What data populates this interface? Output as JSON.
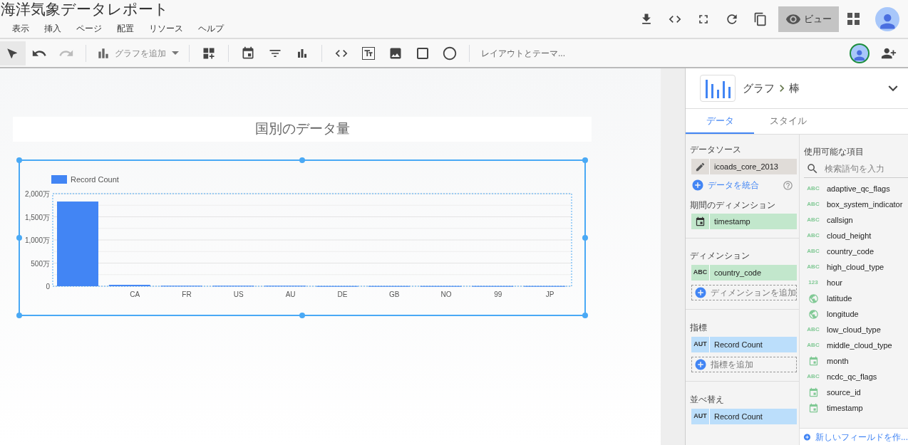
{
  "report": {
    "title": "海洋気象データレポート"
  },
  "menu": [
    "表示",
    "挿入",
    "ページ",
    "配置",
    "リソース",
    "ヘルプ"
  ],
  "header_actions": {
    "view_button": "ビュー",
    "view_selected": true
  },
  "toolbar": {
    "add_chart": "グラフを追加",
    "layout_theme": "レイアウトとテーマ..."
  },
  "canvas": {
    "chart_title": "国別のデータ量",
    "chart": {
      "selected": true,
      "chart_data": {
        "type": "bar",
        "series": [
          {
            "name": "Record Count",
            "color": "#4285f4",
            "values": [
              1830,
              30,
              10,
              10,
              10,
              5,
              5,
              5,
              5,
              5
            ]
          }
        ],
        "categories": [
          null,
          "CA",
          "FR",
          "US",
          "AU",
          "DE",
          "GB",
          "NO",
          "99",
          "JP"
        ],
        "ylim": [
          0,
          2000
        ],
        "grid": true,
        "yticks": [
          {
            "value": 0,
            "label": "0"
          },
          {
            "value": 500,
            "label": "500万"
          },
          {
            "value": 1000,
            "label": "1,000万"
          },
          {
            "value": 1500,
            "label": "1,500万"
          },
          {
            "value": 2000,
            "label": "2,000万"
          }
        ]
      }
    }
  },
  "panel": {
    "breadcrumb": [
      "グラフ",
      "棒"
    ],
    "tabs": [
      {
        "label": "データ",
        "selected": true
      },
      {
        "label": "スタイル",
        "selected": false
      }
    ],
    "data_source": {
      "heading": "データソース",
      "name": "icoads_core_2013",
      "blend_link": "データを統合"
    },
    "date_dimension": {
      "heading": "期間のディメンション",
      "field": {
        "kind": "date",
        "name": "timestamp"
      }
    },
    "dimension": {
      "heading": "ディメンション",
      "field": {
        "kind": "dimension",
        "badge": "ABC",
        "name": "country_code"
      },
      "add": "ディメンションを追加"
    },
    "metric": {
      "heading": "指標",
      "field": {
        "kind": "metric",
        "badge": "AUT",
        "name": "Record Count"
      },
      "add": "指標を追加"
    },
    "sort": {
      "heading": "並べ替え",
      "field": {
        "kind": "metric",
        "badge": "AUT",
        "name": "Record Count"
      }
    },
    "available": {
      "heading": "使用可能な項目",
      "search_placeholder": "検索語句を入力",
      "create_field": "新しいフィールドを作...",
      "fields": [
        {
          "kind": "text",
          "badge": "ABC",
          "name": "adaptive_qc_flags"
        },
        {
          "kind": "text",
          "badge": "ABC",
          "name": "box_system_indicator"
        },
        {
          "kind": "text",
          "badge": "ABC",
          "name": "callsign"
        },
        {
          "kind": "text",
          "badge": "ABC",
          "name": "cloud_height"
        },
        {
          "kind": "text",
          "badge": "ABC",
          "name": "country_code"
        },
        {
          "kind": "text",
          "badge": "ABC",
          "name": "high_cloud_type"
        },
        {
          "kind": "number",
          "badge": "123",
          "name": "hour"
        },
        {
          "kind": "geo",
          "name": "latitude"
        },
        {
          "kind": "geo",
          "name": "longitude"
        },
        {
          "kind": "text",
          "badge": "ABC",
          "name": "low_cloud_type"
        },
        {
          "kind": "text",
          "badge": "ABC",
          "name": "middle_cloud_type"
        },
        {
          "kind": "date",
          "name": "month"
        },
        {
          "kind": "text",
          "badge": "ABC",
          "name": "ncdc_qc_flags"
        },
        {
          "kind": "date",
          "name": "source_id"
        },
        {
          "kind": "date",
          "name": "timestamp"
        }
      ]
    }
  }
}
